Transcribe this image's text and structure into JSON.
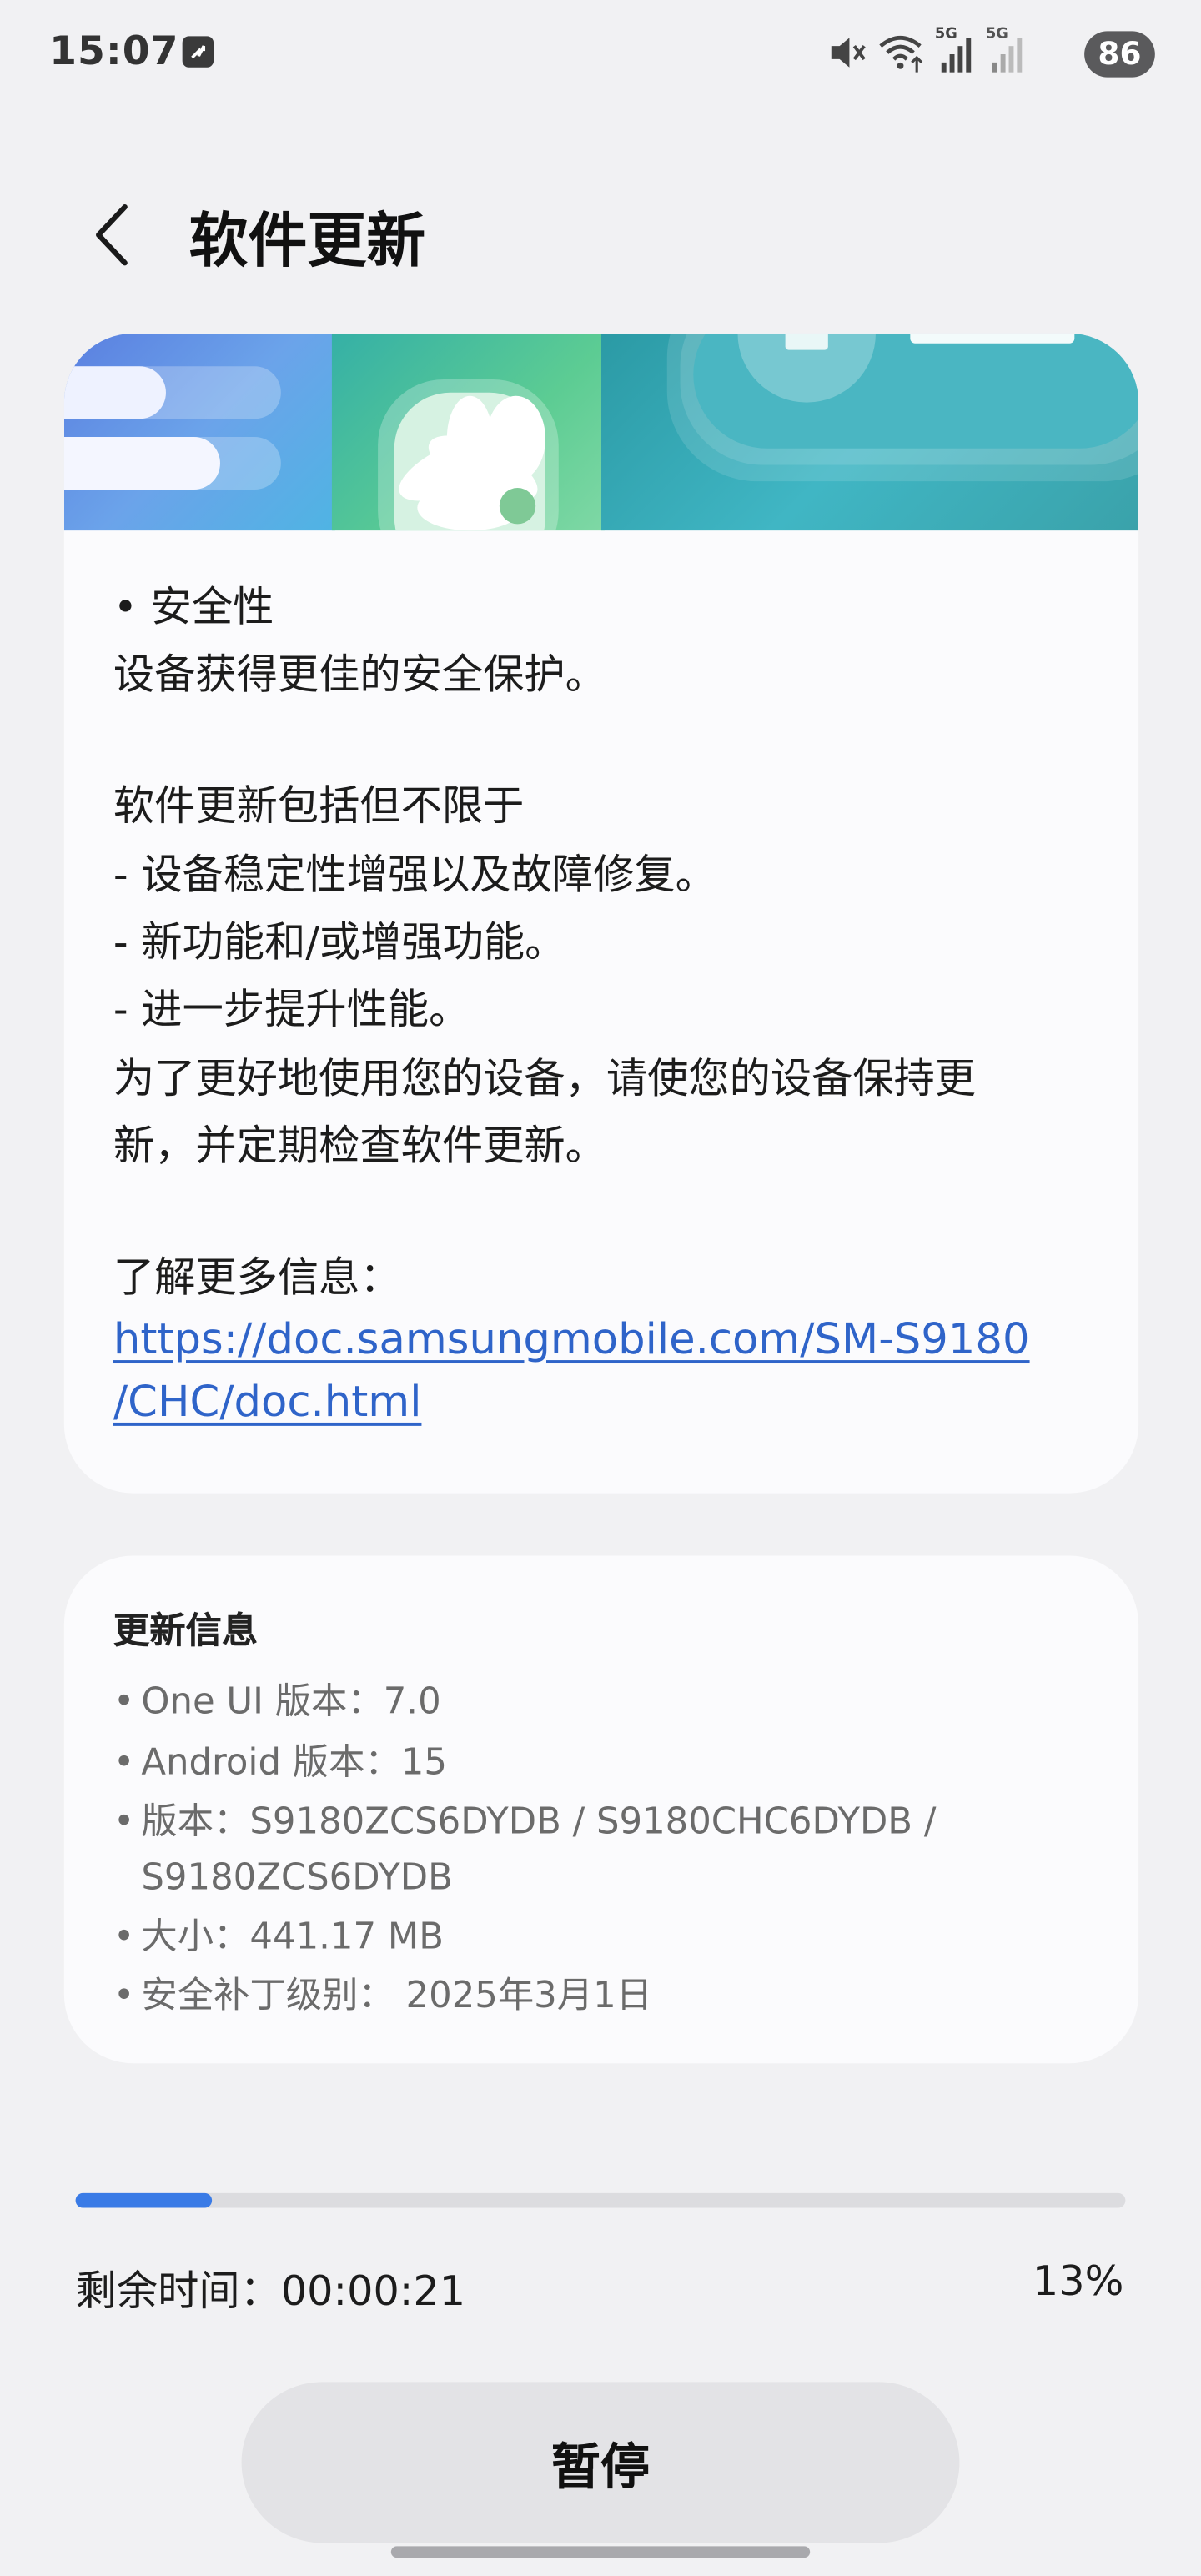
{
  "status_bar": {
    "time": "15:07",
    "network_1": "5G",
    "network_2": "5G",
    "battery": "86",
    "icons": [
      "app-notification-icon",
      "mute-icon",
      "wifi-icon",
      "signal-icon",
      "signal-icon",
      "battery-icon"
    ]
  },
  "header": {
    "title": "软件更新",
    "back_icon": "chevron-left-icon"
  },
  "release_notes": {
    "line_1": "• 安全性",
    "line_2": "设备获得更佳的安全保护。",
    "line_3": "软件更新包括但不限于",
    "line_4": "- 设备稳定性增强以及故障修复。",
    "line_5": "- 新功能和/或增强功能。",
    "line_6": "- 进一步提升性能。",
    "line_7": "为了更好地使用您的设备，请使您的设备保持更",
    "line_8": "新，并定期检查软件更新。",
    "more_info_label": "了解更多信息：",
    "link_line_1": "https://doc.samsungmobile.com/SM-S9180",
    "link_line_2": "/CHC/doc.html"
  },
  "update_info": {
    "title": "更新信息",
    "items": [
      "One UI 版本：7.0",
      "Android 版本：15",
      "版本：S9180ZCS6DYDB / S9180CHC6DYDB /",
      "大小：441.17 MB",
      "安全补丁级别： 2025年3月1日"
    ],
    "item_3_continuation": "S9180ZCS6DYDB"
  },
  "download": {
    "progress_fraction": 0.13,
    "remaining_label": "剩余时间：00:00:21",
    "percent_text": "13%"
  },
  "actions": {
    "pause_label": "暂停"
  },
  "colors": {
    "background": "#f1f1f3",
    "card": "#fbfbfd",
    "accent": "#3a7be6",
    "link": "#2f64c9"
  }
}
